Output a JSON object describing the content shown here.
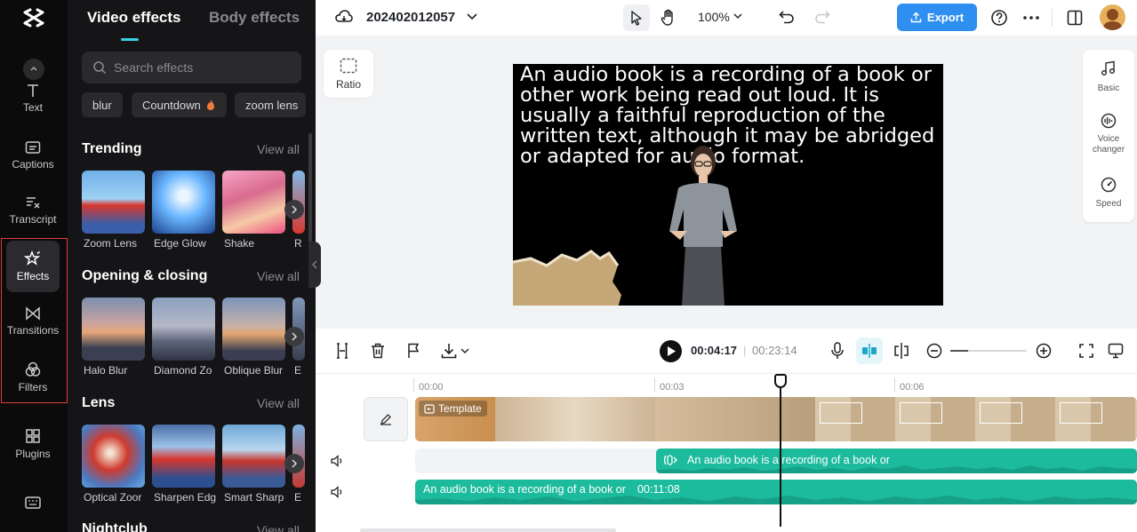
{
  "left_rail": {
    "items": [
      {
        "label": "Text",
        "icon": "text-icon"
      },
      {
        "label": "Captions",
        "icon": "captions-icon"
      },
      {
        "label": "Transcript",
        "icon": "transcript-icon"
      },
      {
        "label": "Effects",
        "icon": "effects-icon",
        "active": true
      },
      {
        "label": "Transitions",
        "icon": "transitions-icon"
      },
      {
        "label": "Filters",
        "icon": "filters-icon"
      },
      {
        "label": "Plugins",
        "icon": "plugins-icon"
      }
    ],
    "highlight_color": "#e23b3b"
  },
  "panel": {
    "tabs": [
      "Video effects",
      "Body effects"
    ],
    "active_tab": "Video effects",
    "search_placeholder": "Search effects",
    "chips": [
      "blur",
      "Countdown",
      "zoom lens"
    ],
    "sections": [
      {
        "title": "Trending",
        "view_all": "View all",
        "items": [
          "Zoom Lens",
          "Edge Glow",
          "Shake",
          "R"
        ]
      },
      {
        "title": "Opening & closing",
        "view_all": "View all",
        "items": [
          "Halo Blur",
          "Diamond Zo",
          "Oblique Blur",
          "E"
        ]
      },
      {
        "title": "Lens",
        "view_all": "View all",
        "items": [
          "Optical Zoor",
          "Sharpen Edg",
          "Smart Sharp",
          "E"
        ]
      },
      {
        "title": "Nightclub",
        "view_all": "View all"
      }
    ]
  },
  "topbar": {
    "project_name": "202402012057",
    "zoom": "100%",
    "export_label": "Export",
    "accent": "#2f8ff0"
  },
  "stage": {
    "ratio_label": "Ratio",
    "caption_text": "An audio book is a recording of a book or other work being read out loud. It is usually  a faithful reproduction of the written text, although it may be abridged or adapted for audio format.",
    "right_tools": [
      {
        "label": "Basic",
        "icon": "music-note-icon"
      },
      {
        "label": "Voice changer",
        "icon": "voice-changer-icon"
      },
      {
        "label": "Speed",
        "icon": "speed-icon"
      }
    ]
  },
  "timeline": {
    "current_time": "00:04:17",
    "total_time": "00:23:14",
    "ruler": [
      "00:00",
      "00:03",
      "00:06"
    ],
    "template_label": "Template",
    "audio_track_1_text": "An audio book is a recording of a book or",
    "audio_track_2_text": "An audio book is a recording of a book or",
    "audio_track_2_duration": "00:11:08",
    "track_color": "#1dbb9e"
  }
}
